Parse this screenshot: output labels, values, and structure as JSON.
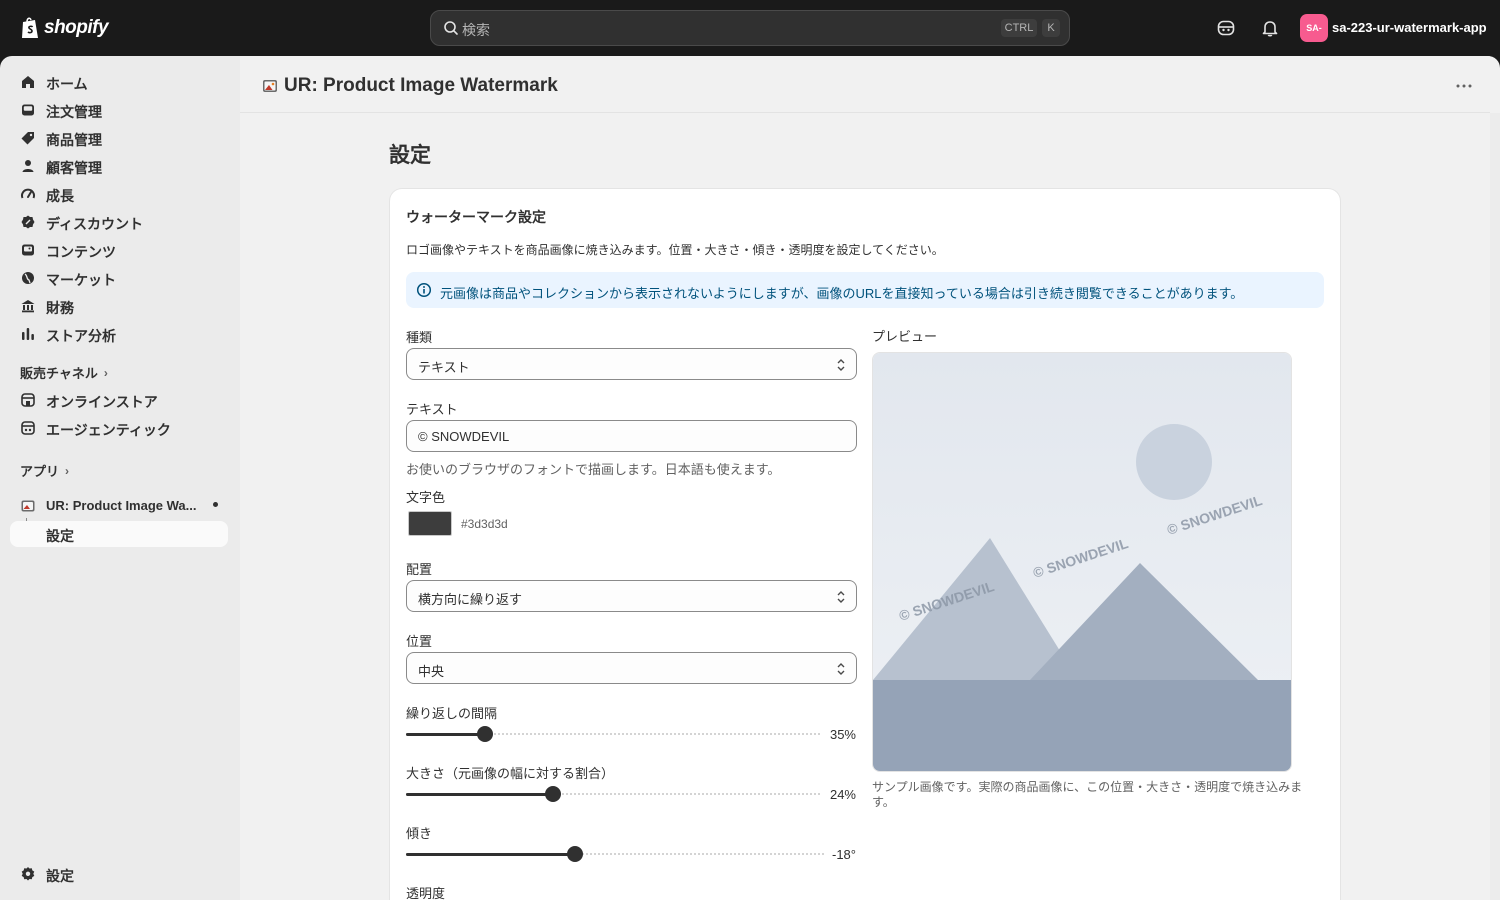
{
  "topbar": {
    "brand": "shopify",
    "search_placeholder": "検索",
    "kbd_ctrl": "CTRL",
    "kbd_k": "K",
    "avatar_initials": "SA-",
    "store_name": "sa-223-ur-watermark-app"
  },
  "sidebar": {
    "items": [
      {
        "label": "ホーム",
        "icon": "home-icon"
      },
      {
        "label": "注文管理",
        "icon": "inbox-icon"
      },
      {
        "label": "商品管理",
        "icon": "tag-icon"
      },
      {
        "label": "顧客管理",
        "icon": "person-icon"
      },
      {
        "label": "成長",
        "icon": "gauge-icon"
      },
      {
        "label": "ディスカウント",
        "icon": "discount-icon"
      },
      {
        "label": "コンテンツ",
        "icon": "image-icon"
      },
      {
        "label": "マーケット",
        "icon": "globe-icon"
      },
      {
        "label": "財務",
        "icon": "bank-icon"
      },
      {
        "label": "ストア分析",
        "icon": "chart-icon"
      }
    ],
    "sales_channels_label": "販売チャネル",
    "channels": [
      {
        "label": "オンラインストア",
        "icon": "store-icon"
      },
      {
        "label": "エージェンティック",
        "icon": "agent-icon"
      }
    ],
    "apps_label": "アプリ",
    "app_item": "UR: Product Image Wa...",
    "app_sub_item": "設定",
    "settings": "設定"
  },
  "app_header": {
    "title": "UR: Product Image Watermark"
  },
  "page": {
    "title": "設定"
  },
  "card": {
    "title": "ウォーターマーク設定",
    "description": "ロゴ画像やテキストを商品画像に焼き込みます。位置・大きさ・傾き・透明度を設定してください。",
    "banner": "元画像は商品やコレクションから表示されないようにしますが、画像のURLを直接知っている場合は引き続き閲覧できることがあります。",
    "type_label": "種類",
    "type_value": "テキスト",
    "text_label": "テキスト",
    "text_value": "© SNOWDEVIL",
    "text_help": "お使いのブラウザのフォントで描画します。日本語も使えます。",
    "color_label": "文字色",
    "color_value": "#3d3d3d",
    "layout_label": "配置",
    "layout_value": "横方向に繰り返す",
    "position_label": "位置",
    "position_value": "中央",
    "spacing_label": "繰り返しの間隔",
    "spacing_value": "35%",
    "spacing_fraction": 0.19,
    "size_label": "大きさ（元画像の幅に対する割合）",
    "size_value": "24%",
    "size_fraction": 0.355,
    "angle_label": "傾き",
    "angle_value": "-18°",
    "angle_fraction": 0.405,
    "opacity_label": "透明度",
    "preview_label": "プレビュー",
    "preview_watermark": "© SNOWDEVIL",
    "preview_caption": "サンプル画像です。実際の商品画像に、この位置・大きさ・透明度で焼き込みます。"
  },
  "colors": {
    "topbar_bg": "#1a1a1a",
    "accent_avatar": "#f75b8f",
    "banner_bg": "#eaf4ff",
    "banner_text": "#00527c"
  }
}
